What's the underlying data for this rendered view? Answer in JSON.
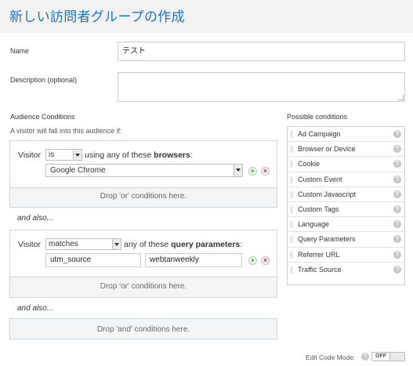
{
  "header": {
    "title": "新しい訪問者グループの作成"
  },
  "form": {
    "name_label": "Name",
    "name_value": "テスト",
    "description_label": "Description (optional)",
    "description_value": ""
  },
  "audience": {
    "title": "Audience Conditions",
    "hint": "A visitor will fall into this audience if:",
    "conditions": [
      {
        "visitor_label": "Visitor",
        "operator": "is",
        "text_prefix": "using any of these ",
        "text_bold": "browsers",
        "text_suffix": ":",
        "value": "Google Chrome",
        "or_hint": "Drop 'or' conditions here."
      },
      {
        "visitor_label": "Visitor",
        "operator": "matches",
        "text_prefix": "any of these ",
        "text_bold": "query parameters",
        "text_suffix": ":",
        "param_name": "utm_source",
        "param_value": "webtanweekly",
        "or_hint": "Drop 'or' conditions here."
      }
    ],
    "and_also_1": "and also...",
    "and_also_2": "and also...",
    "and_hint": "Drop 'and' conditions here."
  },
  "possible_conditions": {
    "title": "Possible conditions",
    "items": [
      "Ad Campaign",
      "Browser or Device",
      "Cookie",
      "Custom Event",
      "Custom Javascript",
      "Custom Tags",
      "Language",
      "Query Parameters",
      "Referrer URL",
      "Traffic Source"
    ]
  },
  "footer": {
    "edit_code_label": "Edit Code Mode:",
    "toggle_off": "OFF"
  },
  "icons": {
    "add": "plus-icon",
    "remove": "close-icon",
    "help": "question-icon"
  },
  "colors": {
    "title": "#1e73be",
    "add": "#3a9b2e",
    "remove": "#c0392b"
  }
}
